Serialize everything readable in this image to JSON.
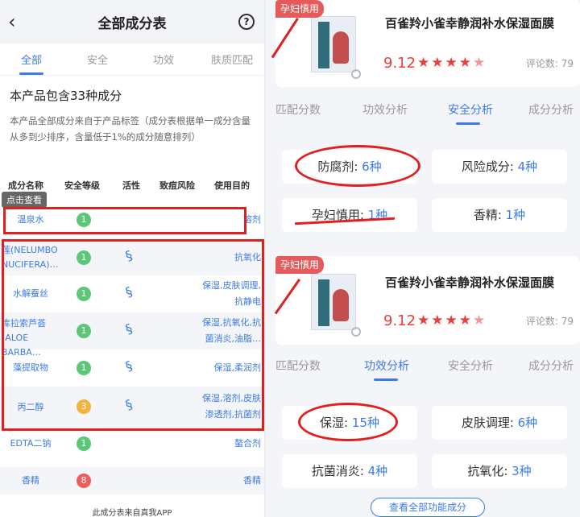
{
  "left": {
    "nav": {
      "back_icon": "‹",
      "title": "全部成分表",
      "help_icon": "?"
    },
    "tabs": [
      "全部",
      "安全",
      "功效",
      "肤质匹配"
    ],
    "summary_title": "本产品包含33种成分",
    "summary_desc": "本产品全部成分来自于产品标签（成分表根据单一成分含量从多到少排序，含量低于1%的成分随意排列）",
    "headers": [
      "成分名称",
      "安全等级",
      "活性",
      "致痘风险",
      "使用目的"
    ],
    "tooltip": "点击查看",
    "rows": [
      {
        "name": "温泉水",
        "level": "1",
        "level_color": "green",
        "active": false,
        "use": "溶剂"
      },
      {
        "name": "莲(NELUMBO NUCIFERA)…",
        "level": "1",
        "level_color": "green",
        "active": true,
        "use": "抗氧化"
      },
      {
        "name": "水解蚕丝",
        "level": "1",
        "level_color": "green",
        "active": true,
        "use": "保湿,皮肤调理,抗静电"
      },
      {
        "name": "库拉索芦荟(ALOE BARBA…",
        "level": "1",
        "level_color": "green",
        "active": true,
        "use": "保湿,抗氧化,抗菌消炎,油脂…"
      },
      {
        "name": "藻提取物",
        "level": "1",
        "level_color": "green",
        "active": true,
        "use": "保湿,柔润剂"
      },
      {
        "name": "丙二醇",
        "level": "3",
        "level_color": "orange",
        "active": true,
        "use": "保湿,溶剂,皮肤渗透剂,抗菌剂"
      },
      {
        "name": "EDTA二钠",
        "level": "1",
        "level_color": "green",
        "active": false,
        "use": "螯合剂"
      },
      {
        "name": "香精",
        "level": "8",
        "level_color": "red",
        "active": false,
        "use": "香精"
      }
    ],
    "footer_note": "此成分表来自真我APP"
  },
  "right": {
    "product": {
      "name": "百雀羚小雀幸静润补水保湿面膜",
      "score": "9.12",
      "stars": "★★★★",
      "half_star": "★",
      "reviews": "评论数: 79",
      "tag": "孕妇慎用"
    },
    "tabs": [
      "匹配分数",
      "功效分析",
      "安全分析",
      "成分分析"
    ],
    "safety": [
      {
        "label": "防腐剂: ",
        "value": "6种"
      },
      {
        "label": "风险成分: ",
        "value": "4种"
      },
      {
        "label": "孕妇慎用: ",
        "value": "1种"
      },
      {
        "label": "香精: ",
        "value": "1种"
      }
    ],
    "efficacy": [
      {
        "label": "保湿: ",
        "value": "15种"
      },
      {
        "label": "皮肤调理: ",
        "value": "6种"
      },
      {
        "label": "抗菌消炎: ",
        "value": "4种"
      },
      {
        "label": "抗氧化: ",
        "value": "3种"
      }
    ],
    "more_button": "查看全部功能成分"
  }
}
